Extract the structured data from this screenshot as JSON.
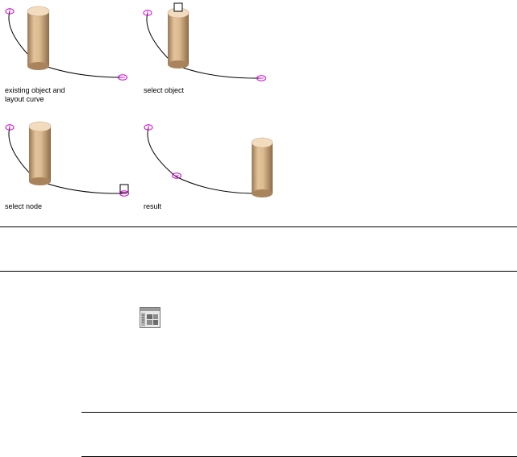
{
  "figure": {
    "panels": [
      {
        "caption": "existing object and\nlayout curve"
      },
      {
        "caption": "select object"
      },
      {
        "caption": "select node"
      },
      {
        "caption": "result"
      }
    ],
    "colors": {
      "node_marker": "#d000d0",
      "curve": "#000000",
      "cylinder_light": "#e9cfae",
      "cylinder_mid": "#c9a47a",
      "cylinder_dark": "#9c7852",
      "cylinder_top": "#f2dcc0"
    }
  },
  "toolbar_icon": {
    "name": "properties-palette-icon"
  }
}
